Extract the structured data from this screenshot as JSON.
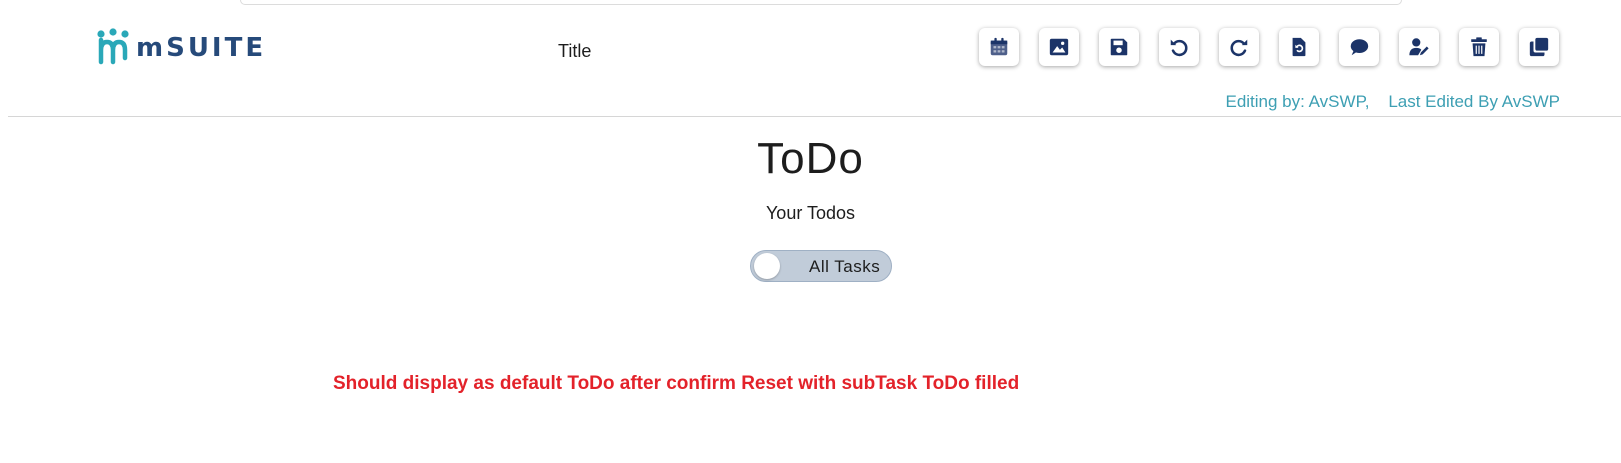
{
  "app": {
    "logo_text": "mSUITE",
    "document_title": "Title"
  },
  "toolbar": {
    "buttons": [
      {
        "icon": "calendar-icon"
      },
      {
        "icon": "image-icon"
      },
      {
        "icon": "save-icon"
      },
      {
        "icon": "undo-icon"
      },
      {
        "icon": "redo-icon"
      },
      {
        "icon": "restore-file-icon"
      },
      {
        "icon": "comment-icon"
      },
      {
        "icon": "user-edit-icon"
      },
      {
        "icon": "trash-icon"
      },
      {
        "icon": "copy-icon"
      }
    ]
  },
  "edit_info": {
    "text": "Editing by: AvSWP,    Last Edited By AvSWP"
  },
  "main": {
    "title": "ToDo",
    "subtitle": "Your Todos",
    "toggle": {
      "label": "All Tasks",
      "checked": false
    }
  },
  "note": {
    "text": "Should display as default ToDo after confirm Reset with subTask ToDo filled"
  },
  "colors": {
    "brand_navy": "#1c3468",
    "brand_teal": "#2aa8b8",
    "edit_info": "#3d9fb3",
    "note_red": "#e3222a"
  }
}
